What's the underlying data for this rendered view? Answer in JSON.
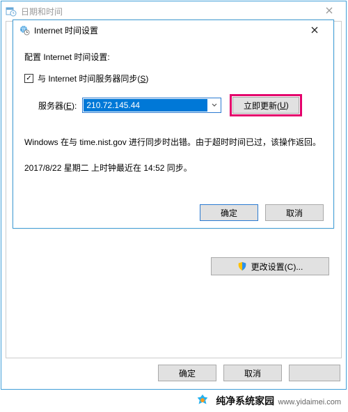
{
  "parent": {
    "title": "日期和时间",
    "ok_label": "确定",
    "cancel_label": "取消",
    "change_settings_label": "更改设置(C)..."
  },
  "dialog": {
    "title": "Internet 时间设置",
    "config_label": "配置 Internet 时间设置:",
    "sync_checkbox_label": "与 Internet 时间服务器同步(S)",
    "sync_checked": true,
    "server_label": "服务器(E):",
    "server_value": "210.72.145.44",
    "update_now_label": "立即更新(U)",
    "status_text": "Windows 在与 time.nist.gov 进行同步时出错。由于超时时间已过，该操作返回。",
    "last_sync_text": "2017/8/22 星期二 上时钟最近在 14:52 同步。",
    "ok_label": "确定",
    "cancel_label": "取消"
  },
  "icons": {
    "datetime": "calendar-clock-icon",
    "globe": "globe-clock-icon",
    "shield": "uac-shield-icon",
    "chevron_down": "chevron-down-icon",
    "close": "close-icon"
  },
  "brand": {
    "name": "纯净系统家园",
    "url": "www.yidaimei.com"
  },
  "colors": {
    "accent": "#3f9ed8",
    "selection": "#0078d7",
    "highlight": "#e4006b"
  }
}
